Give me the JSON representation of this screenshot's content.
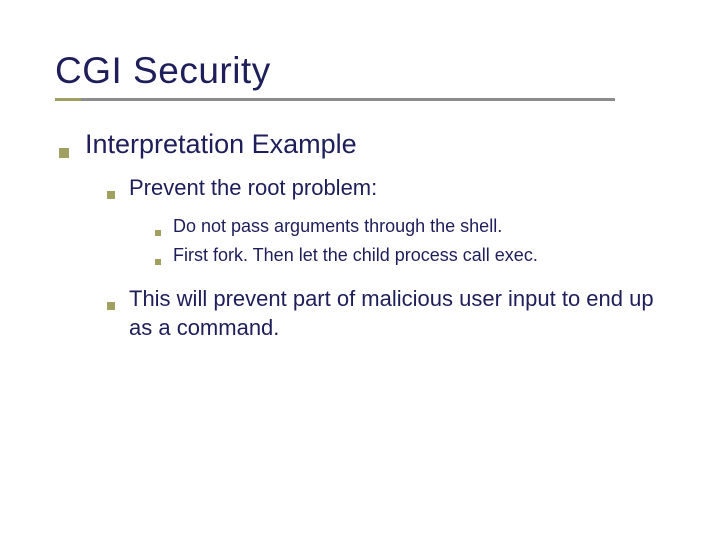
{
  "title": "CGI Security",
  "l1": "Interpretation Example",
  "l2a": "Prevent the root problem:",
  "l3a": "Do not pass arguments through the shell.",
  "l3b": "First fork.  Then let the child process call exec.",
  "l2b": "This will prevent part of malicious user input to end up as a command."
}
